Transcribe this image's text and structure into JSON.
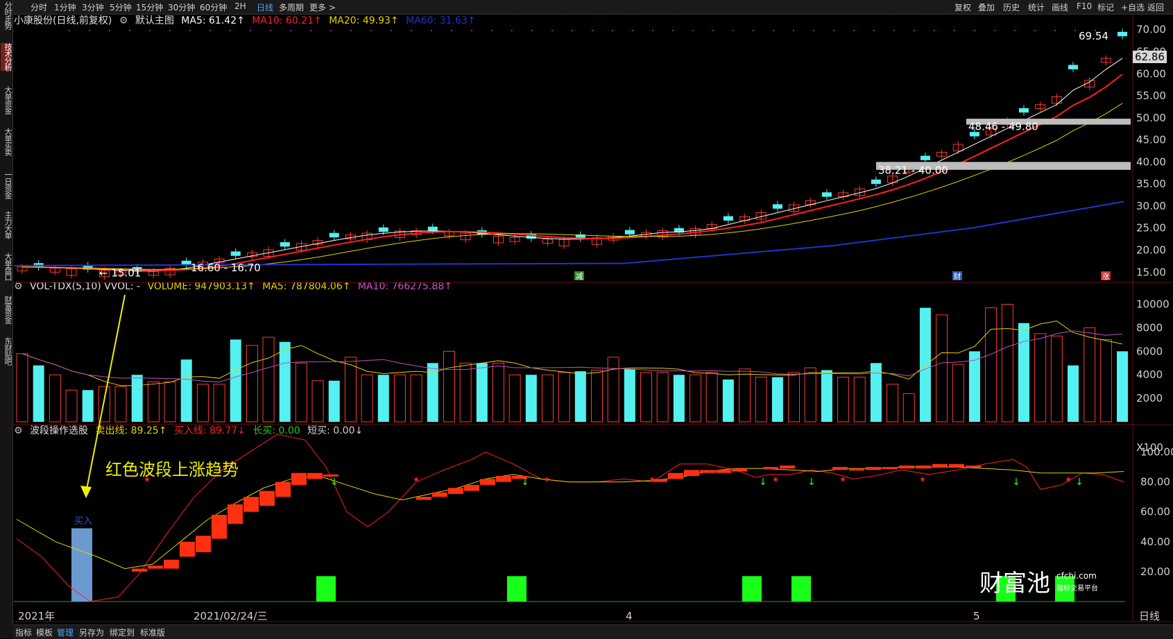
{
  "topbar": {
    "items": [
      "分时",
      "1分钟",
      "3分钟",
      "5分钟",
      "15分钟",
      "30分钟",
      "60分钟",
      "2H",
      "日线",
      "多周期",
      "更多 >"
    ],
    "active_index": 8,
    "right_items": [
      "复权",
      "叠加",
      "历史",
      "统计",
      "画线",
      "F10",
      "标记",
      "+自选",
      "返回"
    ]
  },
  "sidebar": {
    "items": [
      "分时走势",
      "技术分析",
      "大单资金",
      "大单买卖",
      "一日资金",
      "主力大单",
      "大单盘口",
      "财富资金",
      "东财贴吧"
    ],
    "active_index": 1
  },
  "main_chart": {
    "stock_name": "小康股份(日线,前复权)",
    "template": "默认主图",
    "ma5": "MA5: 61.42↑",
    "ma10": "MA10: 60.21↑",
    "ma20": "MA20: 49.93↑",
    "ma60": "MA60: 31.63↑",
    "high_label": "69.54",
    "last_price": "62.86",
    "low_label1": "15.01",
    "low_label2": "16.60 - 16.70",
    "zone1": "48.46 - 49.80",
    "zone2": "38.21 - 40.00",
    "axis": [
      "70.00",
      "65.00",
      "60.00",
      "55.00",
      "50.00",
      "45.00",
      "40.00",
      "35.00",
      "30.00",
      "25.00",
      "20.00",
      "15.00"
    ],
    "markers": [
      "减",
      "财",
      "涨"
    ]
  },
  "vol_chart": {
    "name": "VOL-TDX(5,10) VVOL: -",
    "volume": "VOLUME: 947903.13↑",
    "ma5": "MA5: 787804.06↑",
    "ma10": "MA10: 766275.88↑",
    "axis": [
      "10000",
      "8000",
      "6000",
      "4000",
      "2000",
      "X100"
    ]
  },
  "wave_chart": {
    "name": "波段操作选股",
    "sell_line": "卖出线: 89.25↑",
    "buy_line": "买入线: 89.77↓",
    "long_buy": "长买: 0.00",
    "short_buy": "短买: 0.00↓",
    "annotation": "红色波段上涨趋势",
    "buy_label": "买入",
    "axis": [
      "100.00",
      "80.00",
      "60.00",
      "40.00",
      "20.00"
    ]
  },
  "date_axis": {
    "labels": [
      "2021年",
      "2021/02/24/三",
      "4",
      "5"
    ],
    "right": "日线"
  },
  "bottombar": {
    "items": [
      "指标",
      "模板",
      "管理",
      "另存为",
      "绑定到",
      "标准版"
    ],
    "active_index": 2
  },
  "watermark": {
    "brand": "财富池",
    "url": "cfchi.com",
    "tagline": "指标交易平台"
  },
  "colors": {
    "up": "#ff3b30",
    "down": "#55f0f0",
    "ma5": "#ffffff",
    "ma10": "#ff2020",
    "ma20": "#e6d200",
    "ma60": "#2233cc",
    "accent": "#4da3ff"
  }
}
